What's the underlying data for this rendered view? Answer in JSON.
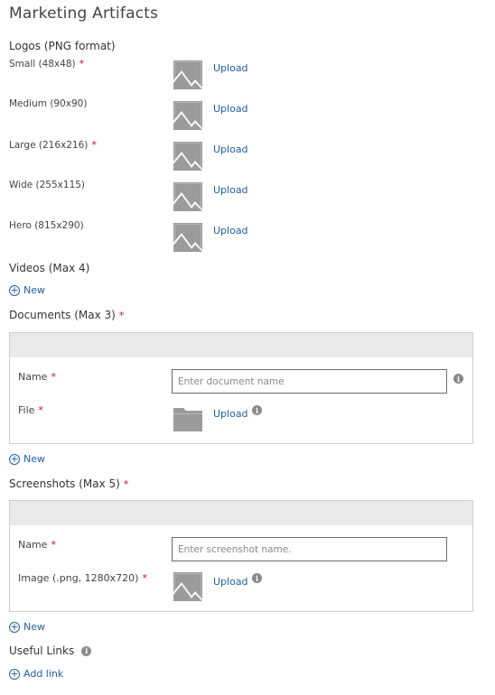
{
  "page": {
    "title": "Marketing Artifacts"
  },
  "logos": {
    "heading": "Logos (PNG format)",
    "upload_label": "Upload",
    "items": [
      {
        "label": "Small (48x48)",
        "required": true
      },
      {
        "label": "Medium (90x90)",
        "required": false
      },
      {
        "label": "Large (216x216)",
        "required": true
      },
      {
        "label": "Wide (255x115)",
        "required": false
      },
      {
        "label": "Hero (815x290)",
        "required": false
      }
    ]
  },
  "videos": {
    "heading": "Videos (Max 4)",
    "new_label": "New"
  },
  "documents": {
    "heading": "Documents (Max 3)",
    "name_label": "Name",
    "name_placeholder": "Enter document name",
    "file_label": "File",
    "upload_label": "Upload",
    "new_label": "New"
  },
  "screenshots": {
    "heading": "Screenshots (Max 5)",
    "name_label": "Name",
    "name_placeholder": "Enter screenshot name.",
    "image_label": "Image (.png, 1280x720)",
    "upload_label": "Upload",
    "new_label": "New"
  },
  "links": {
    "heading": "Useful Links",
    "add_label": "Add link"
  },
  "colors": {
    "accent": "#1f5fa8",
    "required": "#c50f1f",
    "placeholder_icon": "#9b9b9b"
  },
  "icons": {
    "image_placeholder": "image-placeholder-icon",
    "folder": "folder-icon",
    "info": "info-icon",
    "add": "add-circle-icon"
  },
  "required_mark": "*",
  "info_glyph": "i",
  "plus_glyph": "+"
}
